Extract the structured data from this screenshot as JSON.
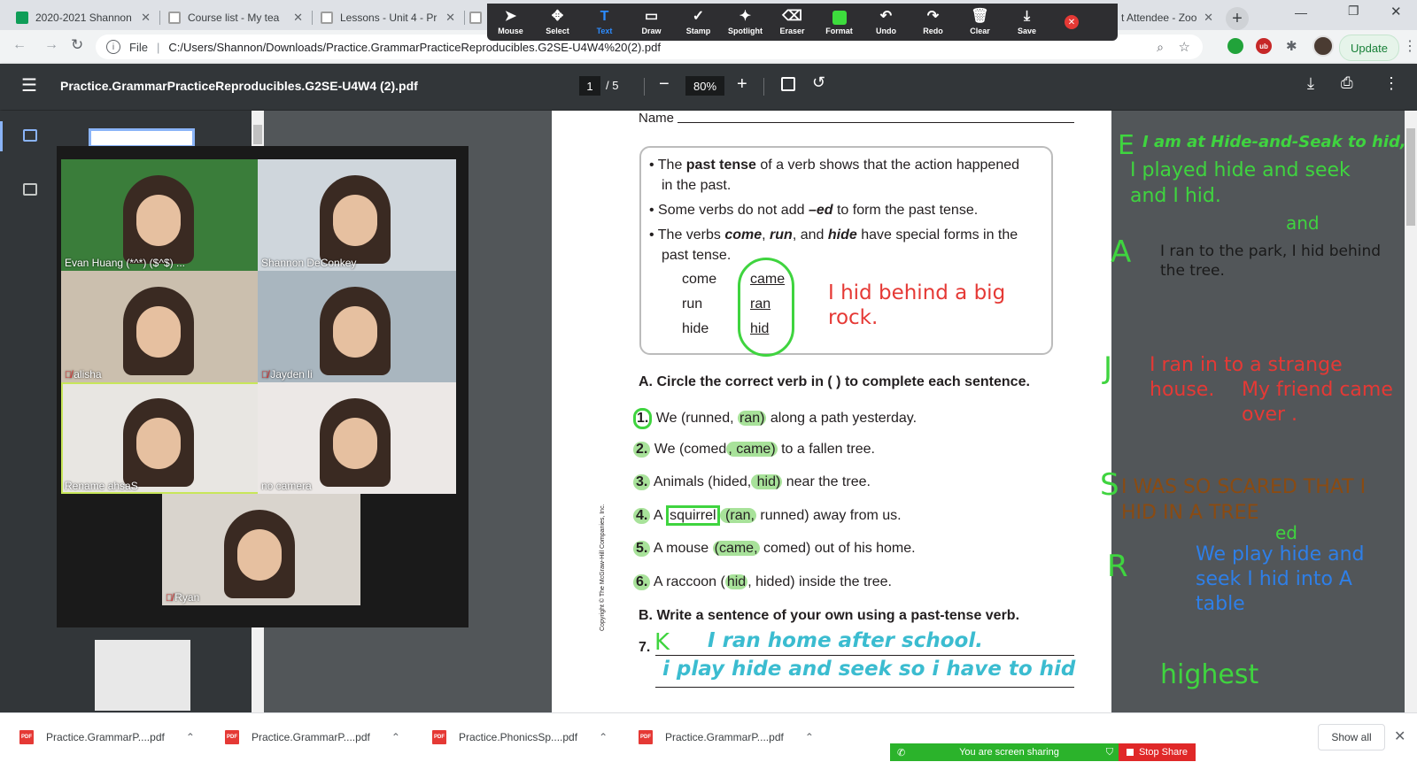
{
  "browser": {
    "tabs": [
      {
        "title": "2020-2021 Shannon",
        "favicon_color": "#0f9d58"
      },
      {
        "title": "Course list - My tea",
        "favicon_color": "#9e9e9e"
      },
      {
        "title": "Lessons - Unit 4 - Pr",
        "favicon_color": "#9e9e9e"
      },
      {
        "title": "",
        "favicon_color": "#9e9e9e"
      },
      {
        "title": "t Attendee - Zoo",
        "favicon_color": "#2d8cff"
      }
    ],
    "new_tab": "+",
    "url_scheme": "File",
    "url": "C:/Users/Shannon/Downloads/Practice.GrammarPracticeReproducibles.G2SE-U4W4%20(2).pdf",
    "update_label": "Update"
  },
  "zoom_toolbar": {
    "tools": [
      {
        "label": "Mouse",
        "icon": "cursor-icon"
      },
      {
        "label": "Select",
        "icon": "move-icon"
      },
      {
        "label": "Text",
        "icon": "text-icon"
      },
      {
        "label": "Draw",
        "icon": "rectangle-icon"
      },
      {
        "label": "Stamp",
        "icon": "checkmark-icon"
      },
      {
        "label": "Spotlight",
        "icon": "wand-icon"
      },
      {
        "label": "Eraser",
        "icon": "eraser-icon"
      },
      {
        "label": "Format",
        "icon": "color-swatch-icon"
      },
      {
        "label": "Undo",
        "icon": "undo-icon"
      },
      {
        "label": "Redo",
        "icon": "redo-icon"
      },
      {
        "label": "Clear",
        "icon": "trash-icon"
      },
      {
        "label": "Save",
        "icon": "save-icon"
      }
    ],
    "active_tool": "Text",
    "format_color": "#3ddc3d",
    "close_color": "#e53935"
  },
  "pdf": {
    "filename": "Practice.GrammarPracticeReproducibles.G2SE-U4W4 (2).pdf",
    "page_current": "1",
    "page_total": "/  5",
    "zoom": "80%"
  },
  "worksheet": {
    "name_label": "Name",
    "rules": [
      {
        "pre": "The ",
        "bold": "past tense",
        "post": " of a verb shows that the action happened"
      },
      {
        "pre": "in the past.",
        "bold": "",
        "post": ""
      },
      {
        "pre": "Some verbs do not add ",
        "bold": "–ed",
        "post": " to form the past tense."
      },
      {
        "pre": "The verbs ",
        "bold": "come",
        "post": ", "
      },
      {
        "pre": "past tense.",
        "bold": "",
        "post": ""
      }
    ],
    "rule3_rest": {
      "run": "run",
      "and": ", and ",
      "hide": "hide",
      "tail": " have special forms in the"
    },
    "verb_pairs": [
      {
        "present": "come",
        "past": "came"
      },
      {
        "present": "run",
        "past": "ran"
      },
      {
        "present": "hide",
        "past": "hid"
      }
    ],
    "teacher_note": "I hid behind a big rock.",
    "section_a": "A. Circle the correct verb in ( ) to complete each sentence.",
    "items": [
      {
        "n": "1.",
        "a": "We (runned, ",
        "ans": "ran)",
        "b": " along a path yesterday."
      },
      {
        "n": "2.",
        "a": "We (comed",
        "ans": ", came)",
        "b": " to a fallen tree."
      },
      {
        "n": "3.",
        "a": "Animals (hided,",
        "ans": " hid)",
        "b": " near the tree."
      },
      {
        "n": "4.",
        "a": "A ",
        "word": "squirrel",
        "ans": " (ran,",
        "b": " runned) away from us."
      },
      {
        "n": "5.",
        "a": "A mouse ",
        "ans": "(came,",
        "b": " comed) out of his home."
      },
      {
        "n": "6.",
        "a": "A raccoon (",
        "ans": "hid",
        "b": ", hided) inside the tree."
      }
    ],
    "section_b": "B. Write a sentence of your own using a past-tense verb.",
    "item7_num": "7.",
    "item7_initial": "K",
    "answer_k": "I ran home after school.",
    "answer_2": "i play hide and seek so i have to hid",
    "copyright": "Copyright © The McGraw-Hill Companies, Inc."
  },
  "student_notes": [
    {
      "initial": "E",
      "text": "I am at Hide-and-Seak to hid,",
      "color": "#3fd43f"
    },
    {
      "initial": "",
      "text": "I played hide and seek",
      "color": "#3fd43f"
    },
    {
      "initial": "",
      "text": "and I hid.",
      "color": "#3fd43f"
    },
    {
      "initial": "A",
      "text": "I ran to the park, I hid behind",
      "color": "#1a1a1a",
      "extra": "and"
    },
    {
      "initial": "",
      "text": "the tree.",
      "color": "#1a1a1a"
    },
    {
      "initial": "J",
      "text": "I ran in to a strange",
      "color": "#e53935"
    },
    {
      "initial": "",
      "text": "house.",
      "color": "#e53935"
    },
    {
      "initial": "",
      "text": "My friend came",
      "color": "#e53935"
    },
    {
      "initial": "",
      "text": "over .",
      "color": "#e53935"
    },
    {
      "initial": "S",
      "text": "I WAS SO SCARED THAT I",
      "color": "#8a4b12"
    },
    {
      "initial": "",
      "text": "HID IN A TREE",
      "color": "#8a4b12"
    },
    {
      "initial": "R",
      "text": "We play  hide and",
      "color": "#2e7fe8",
      "extra": "ed"
    },
    {
      "initial": "",
      "text": "seek I hid into A",
      "color": "#2e7fe8"
    },
    {
      "initial": "",
      "text": "table",
      "color": "#2e7fe8"
    },
    {
      "initial": "",
      "text": "highest",
      "color": "#3fd43f"
    }
  ],
  "participants": [
    {
      "name": "Evan Huang (*^*) ($^$) ...",
      "muted": false,
      "bg": "#3a7d3a"
    },
    {
      "name": "Shannon DeConkey",
      "muted": false,
      "bg": "#cfd6dc"
    },
    {
      "name": "alisha",
      "muted": true,
      "bg": "#cbbfae"
    },
    {
      "name": "Jayden li",
      "muted": true,
      "bg": "#a9b6bf"
    },
    {
      "name": "Rename ahsaS",
      "muted": false,
      "bg": "#e8e6e2"
    },
    {
      "name": "no camera",
      "muted": false,
      "bg": "#ece8e6"
    },
    {
      "name": "Ryan",
      "muted": true,
      "bg": "#d9d4cd"
    }
  ],
  "downloads": [
    {
      "name": "Practice.GrammarP....pdf"
    },
    {
      "name": "Practice.GrammarP....pdf"
    },
    {
      "name": "Practice.PhonicsSp....pdf"
    },
    {
      "name": "Practice.GrammarP....pdf"
    }
  ],
  "show_all": "Show all",
  "sharing": {
    "status": "You are screen sharing",
    "stop": "Stop Share"
  }
}
